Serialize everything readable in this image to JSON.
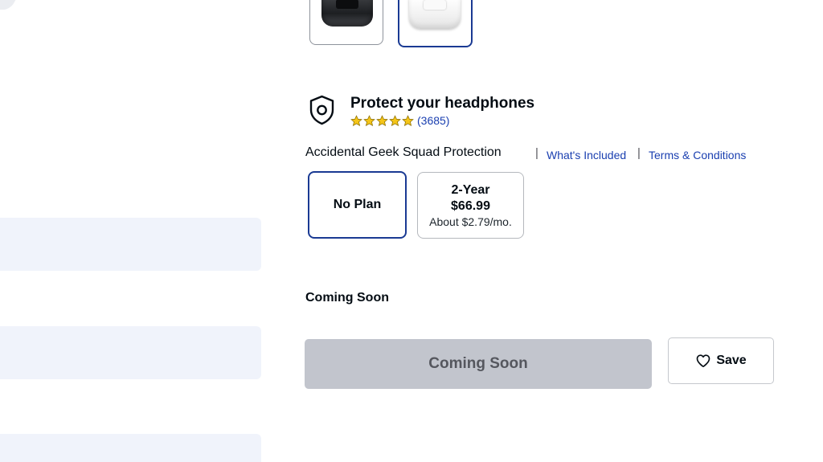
{
  "color_options": {
    "swatches": [
      {
        "name": "Black",
        "selected": false
      },
      {
        "name": "White",
        "selected": true
      }
    ]
  },
  "protection": {
    "title": "Protect your headphones",
    "rating": 5,
    "review_count": "(3685)",
    "plan_name": "Accidental Geek Squad Protection",
    "links": {
      "whats_included": "What's Included",
      "terms": "Terms & Conditions"
    },
    "plans": {
      "none": {
        "label": "No Plan",
        "selected": true
      },
      "two_year": {
        "term": "2-Year",
        "price": "$66.99",
        "monthly": "About $2.79/mo.",
        "selected": false
      }
    }
  },
  "availability": {
    "status": "Coming Soon"
  },
  "actions": {
    "cta_label": "Coming Soon",
    "save_label": "Save"
  },
  "colors": {
    "selected_border": "#1a3a93",
    "link": "#1a3fb0",
    "disabled_button": "#c2c5cd",
    "skeleton": "#f0f3fb",
    "star": "#f5c518"
  },
  "icons": {
    "shield": "shield-icon",
    "star": "star-icon",
    "heart": "heart-icon"
  }
}
